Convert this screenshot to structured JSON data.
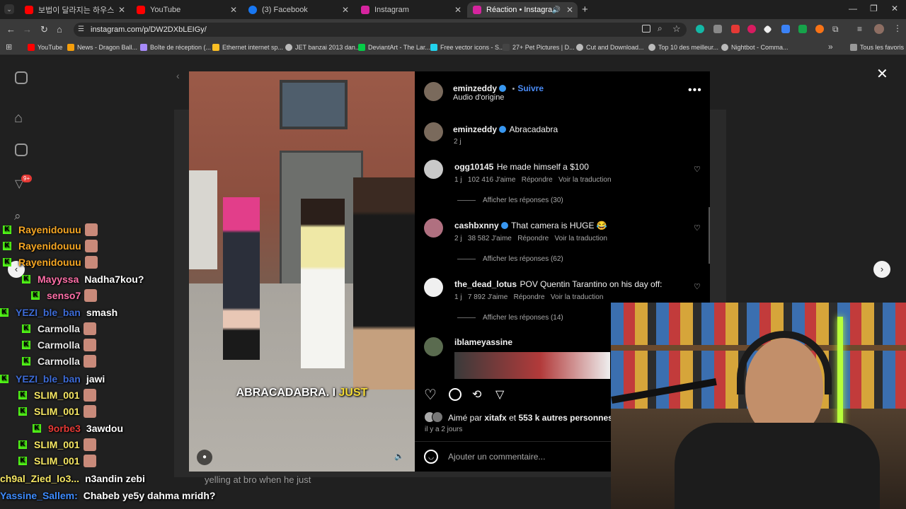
{
  "tabs": [
    {
      "label": "보법이 달라지는 하우스 - YouTub",
      "color": "#ff0000"
    },
    {
      "label": "YouTube",
      "color": "#ff0000"
    },
    {
      "label": "(3) Facebook",
      "color": "#1877f2"
    },
    {
      "label": "Instagram",
      "color": "#d6249f"
    },
    {
      "label": "Réaction • Instagram",
      "color": "#d6249f"
    }
  ],
  "url": "instagram.com/p/DW2DXbLEIGy/",
  "bookmarks": [
    "YouTube",
    "News - Dragon Ball...",
    "Boîte de réception (...",
    "Ethernet internet sp...",
    "JET banzai 2013 dan...",
    "DeviantArt - The Lar...",
    "Free vector icons - S...",
    "27+ Pet Pictures | D...",
    "Cut and Download...",
    "Top 10 des meilleur...",
    "Nightbot - Comma..."
  ],
  "all_bookmarks": "Tous les favoris",
  "side_badge": "9+",
  "post": {
    "author": "eminzeddy",
    "follow": "Suivre",
    "audio": "Audio d'origine",
    "caption_user": "eminzeddy",
    "caption": "Abracadabra",
    "caption_time": "2 j",
    "video_subtitle_a": "ABRACADABRA. I",
    "video_subtitle_b": "JUST",
    "under_video_caption": "yelling at bro when he just"
  },
  "comments": [
    {
      "user": "ogg10145",
      "text": "He made himself a $100",
      "time": "1 j",
      "likes": "102 416 J'aime",
      "reply": "Répondre",
      "translate": "Voir la traduction",
      "replies": "Afficher les réponses (30)"
    },
    {
      "user": "cashbxnny",
      "text": "That camera is HUGE 😂",
      "time": "2 j",
      "likes": "38 582 J'aime",
      "reply": "Répondre",
      "translate": "Voir la traduction",
      "replies": "Afficher les réponses (62)"
    },
    {
      "user": "the_dead_lotus",
      "text": "POV Quentin Tarantino on his day off:",
      "time": "1 j",
      "likes": "7 892 J'aime",
      "reply": "Répondre",
      "translate": "Voir la traduction",
      "replies": "Afficher les réponses (14)"
    },
    {
      "user": "iblameyassine",
      "text": "",
      "time": "",
      "likes": "",
      "reply": "",
      "translate": "",
      "replies": ""
    }
  ],
  "likes_line": {
    "prefix": "Aimé par",
    "user": "xitafx",
    "mid": "et",
    "count": "553 k autres personnes"
  },
  "post_time": "il y a 2 jours",
  "comment_placeholder": "Ajouter un commentaire...",
  "chat": [
    {
      "user": "Rayenidouuu",
      "msg": "",
      "color": "#f5a623",
      "badge": true,
      "emote": true
    },
    {
      "user": "Rayenidouuu",
      "msg": "",
      "color": "#f5a623",
      "badge": true,
      "emote": true
    },
    {
      "user": "Rayenidouuu",
      "msg": "",
      "color": "#f5a623",
      "badge": true,
      "emote": true
    },
    {
      "user": "Mayyssa",
      "msg": "Nadha7kou?",
      "color": "#ff6fa8",
      "badge": true,
      "emote": false
    },
    {
      "user": "senso7",
      "msg": "",
      "color": "#ff6fa8",
      "badge": true,
      "emote": true
    },
    {
      "user": "YEZI_ble_ban",
      "msg": "smash",
      "color": "#3d6bd6",
      "badge": true,
      "emote": false
    },
    {
      "user": "Carmolla",
      "msg": "",
      "color": "#e8e8e8",
      "badge": true,
      "emote": true
    },
    {
      "user": "Carmolla",
      "msg": "",
      "color": "#e8e8e8",
      "badge": true,
      "emote": true
    },
    {
      "user": "Carmolla",
      "msg": "",
      "color": "#e8e8e8",
      "badge": true,
      "emote": true
    },
    {
      "user": "YEZI_ble_ban",
      "msg": "jawi",
      "color": "#3d6bd6",
      "badge": true,
      "emote": false
    },
    {
      "user": "SLIM_001",
      "msg": "",
      "color": "#f5e663",
      "badge": true,
      "emote": true
    },
    {
      "user": "SLIM_001",
      "msg": "",
      "color": "#f5e663",
      "badge": true,
      "emote": true
    },
    {
      "user": "9orbe3",
      "msg": "3awdou",
      "color": "#e53935",
      "badge": true,
      "emote": false
    },
    {
      "user": "SLIM_001",
      "msg": "",
      "color": "#f5e663",
      "badge": true,
      "emote": true
    },
    {
      "user": "SLIM_001",
      "msg": "",
      "color": "#f5e663",
      "badge": true,
      "emote": true
    },
    {
      "user": "ch9al_Zied_lo3...",
      "msg": "n3andin zebi",
      "color": "#f5e663",
      "badge": false,
      "emote": false
    },
    {
      "user": "Yassine_Sallem:",
      "msg": "Chabeb ye5y dahma mridh?",
      "color": "#3d8bfd",
      "badge": false,
      "emote": false
    }
  ]
}
